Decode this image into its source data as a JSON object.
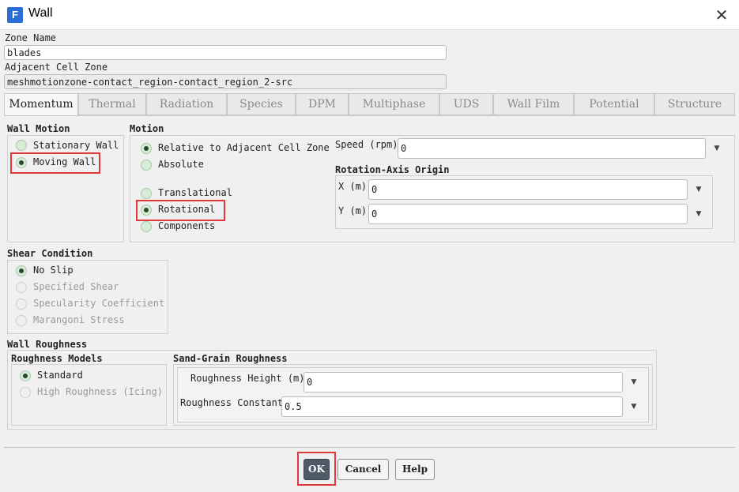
{
  "window": {
    "title": "Wall",
    "app_icon_letter": "F"
  },
  "zone": {
    "name_label": "Zone Name",
    "name_value": "blades",
    "adjacent_label": "Adjacent Cell Zone",
    "adjacent_value": "meshmotionzone-contact_region-contact_region_2-src"
  },
  "tabs": [
    "Momentum",
    "Thermal",
    "Radiation",
    "Species",
    "DPM",
    "Multiphase",
    "UDS",
    "Wall Film",
    "Potential",
    "Structure"
  ],
  "active_tab": "Momentum",
  "wall_motion": {
    "title": "Wall Motion",
    "options": [
      "Stationary Wall",
      "Moving Wall"
    ],
    "selected": "Moving Wall"
  },
  "motion": {
    "title": "Motion",
    "reference_options": [
      "Relative to Adjacent Cell Zone",
      "Absolute"
    ],
    "reference_selected": "Relative to Adjacent Cell Zone",
    "type_options": [
      "Translational",
      "Rotational",
      "Components"
    ],
    "type_selected": "Rotational",
    "speed_label": "Speed (rpm)",
    "speed_value": "0",
    "axis_origin_title": "Rotation-Axis Origin",
    "x_label": "X (m)",
    "x_value": "0",
    "y_label": "Y (m)",
    "y_value": "0"
  },
  "shear": {
    "title": "Shear Condition",
    "options": [
      "No Slip",
      "Specified Shear",
      "Specularity Coefficient",
      "Marangoni Stress"
    ],
    "selected": "No Slip"
  },
  "roughness": {
    "title": "Wall Roughness",
    "models_title": "Roughness Models",
    "model_options": [
      "Standard",
      "High Roughness (Icing)"
    ],
    "model_selected": "Standard",
    "sand_title": "Sand-Grain Roughness",
    "height_label": "Roughness Height (m)",
    "height_value": "0",
    "constant_label": "Roughness Constant",
    "constant_value": "0.5"
  },
  "buttons": {
    "ok": "OK",
    "cancel": "Cancel",
    "help": "Help"
  },
  "icons": {
    "close": "close-icon",
    "dropdown": "chevron-down-icon"
  },
  "colors": {
    "highlight": "#e0383b",
    "primary_button": "#4e5a66",
    "app_icon": "#2b6fd6"
  }
}
